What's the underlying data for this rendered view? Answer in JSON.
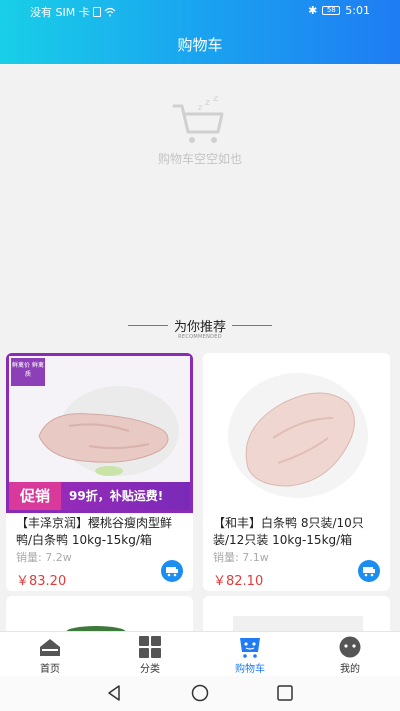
{
  "status_bar": {
    "carrier": "没有 SIM 卡",
    "time": "5:01",
    "battery": "58"
  },
  "header": {
    "title": "购物车"
  },
  "empty_cart": {
    "message": "购物车空空如也",
    "icon": "empty-cart-icon"
  },
  "recommend": {
    "title": "为你推荐",
    "subtitle": "RECOMMENDED"
  },
  "products": [
    {
      "name": "【丰泽京润】樱桃谷瘦肉型鲜鸭/白条鸭 10kg-15kg/箱",
      "sales_label": "销量:",
      "sales_value": "7.2w",
      "price": "￥83.20",
      "promo_badge": "促销",
      "promo_text": "99折，补贴运费!",
      "corner_badge": "鲜禽价 鲜禽质"
    },
    {
      "name": "【和丰】白条鸭 8只装/10只装/12只装 10kg-15kg/箱",
      "sales_label": "销量:",
      "sales_value": "7.1w",
      "price": "￥82.10"
    }
  ],
  "tabs": [
    {
      "label": "首页",
      "icon": "home-icon"
    },
    {
      "label": "分类",
      "icon": "category-grid-icon"
    },
    {
      "label": "购物车",
      "icon": "cart-icon",
      "active": true
    },
    {
      "label": "我的",
      "icon": "profile-icon"
    }
  ],
  "colors": {
    "accent": "#1f7cf3",
    "price": "#e23b3b",
    "promo_purple": "#8b2bb5"
  }
}
